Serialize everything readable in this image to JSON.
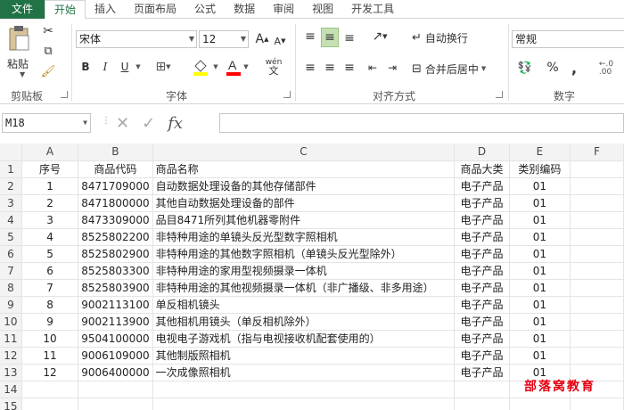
{
  "tabs": [
    "文件",
    "开始",
    "插入",
    "页面布局",
    "公式",
    "数据",
    "审阅",
    "视图",
    "开发工具"
  ],
  "active_tab": "开始",
  "clipboard": {
    "paste_label": "粘贴",
    "group_label": "剪贴板"
  },
  "font": {
    "name": "宋体",
    "size": "12",
    "group_label": "字体",
    "bold": "B",
    "italic": "I",
    "underline": "U",
    "grow": "A",
    "shrink": "A",
    "phonetic": "wén"
  },
  "alignment": {
    "wrap_label": "自动换行",
    "merge_label": "合并后居中",
    "group_label": "对齐方式"
  },
  "number": {
    "format": "常规",
    "group_label": "数字",
    "percent": "%",
    "comma": ","
  },
  "formula_bar": {
    "name_box": "M18",
    "fx": "fx",
    "value": ""
  },
  "columns": [
    "A",
    "B",
    "C",
    "D",
    "E",
    "F"
  ],
  "rows": [
    {
      "n": "1",
      "a": "序号",
      "b": "商品代码",
      "c": "商品名称",
      "d": "商品大类",
      "e": "类别编码"
    },
    {
      "n": "2",
      "a": "1",
      "b": "8471709000",
      "c": "自动数据处理设备的其他存储部件",
      "d": "电子产品",
      "e": "01"
    },
    {
      "n": "3",
      "a": "2",
      "b": "8471800000",
      "c": "其他自动数据处理设备的部件",
      "d": "电子产品",
      "e": "01"
    },
    {
      "n": "4",
      "a": "3",
      "b": "8473309000",
      "c": "品目8471所列其他机器零附件",
      "d": "电子产品",
      "e": "01"
    },
    {
      "n": "5",
      "a": "4",
      "b": "8525802200",
      "c": "非特种用途的单镜头反光型数字照相机",
      "d": "电子产品",
      "e": "01"
    },
    {
      "n": "6",
      "a": "5",
      "b": "8525802900",
      "c": "非特种用途的其他数字照相机（单镜头反光型除外）",
      "d": "电子产品",
      "e": "01"
    },
    {
      "n": "7",
      "a": "6",
      "b": "8525803300",
      "c": "非特种用途的家用型视频摄录一体机",
      "d": "电子产品",
      "e": "01"
    },
    {
      "n": "8",
      "a": "7",
      "b": "8525803900",
      "c": "非特种用途的其他视频摄录一体机（非广播级、非多用途）",
      "d": "电子产品",
      "e": "01"
    },
    {
      "n": "9",
      "a": "8",
      "b": "9002113100",
      "c": "单反相机镜头",
      "d": "电子产品",
      "e": "01"
    },
    {
      "n": "10",
      "a": "9",
      "b": "9002113900",
      "c": "其他相机用镜头（单反相机除外）",
      "d": "电子产品",
      "e": "01"
    },
    {
      "n": "11",
      "a": "10",
      "b": "9504100000",
      "c": "电视电子游戏机（指与电视接收机配套使用的）",
      "d": "电子产品",
      "e": "01"
    },
    {
      "n": "12",
      "a": "11",
      "b": "9006109000",
      "c": "其他制版照相机",
      "d": "电子产品",
      "e": "01"
    },
    {
      "n": "13",
      "a": "12",
      "b": "9006400000",
      "c": "一次成像照相机",
      "d": "电子产品",
      "e": "01"
    }
  ],
  "empty_rows": [
    "14",
    "15"
  ],
  "watermark": "部落窝教育",
  "colors": {
    "accent": "#217346",
    "watermark": "#e60012"
  }
}
